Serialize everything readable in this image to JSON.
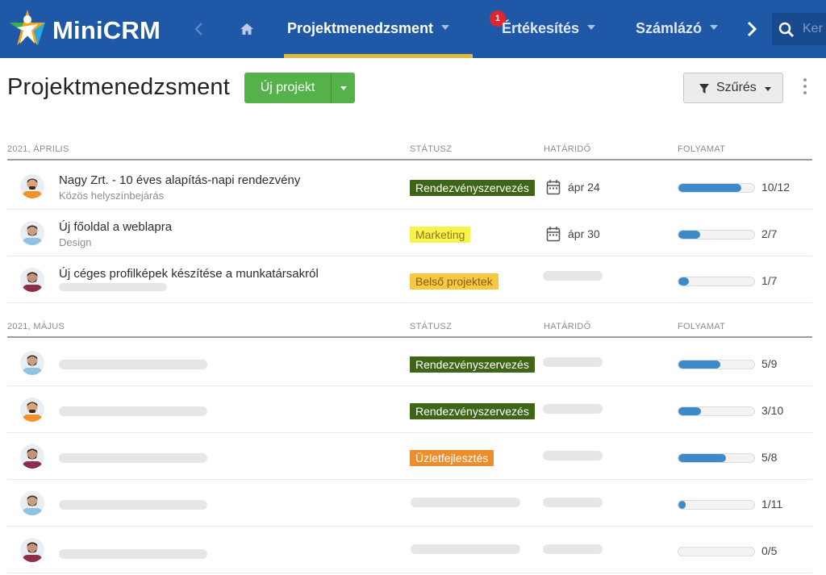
{
  "app": {
    "brand": "MiniCRM",
    "logo_icon": "star-person-logo",
    "colors": {
      "topbar": "#1f58a6",
      "accent_underline": "#e3b93b",
      "primary_button": "#55b24a",
      "progress": "#3d8ac9"
    }
  },
  "nav": {
    "back_icon": "chevron-left-icon",
    "home_icon": "home-icon",
    "tabs": [
      {
        "label": "Projektmenedzsment",
        "active": true
      },
      {
        "label": "Értékesítés",
        "badge": "1"
      },
      {
        "label": "Számlázó"
      }
    ],
    "next_icon": "chevron-right-icon",
    "search_placeholder": "Ker"
  },
  "header": {
    "title": "Projektmenedzsment",
    "new_button": "Új projekt",
    "filter_button": "Szűrés"
  },
  "groups": [
    {
      "label": "2021, ÁPRILIS",
      "columns": {
        "status": "STÁTUSZ",
        "due": "HATÁRIDŐ",
        "progress": "FOLYAMAT"
      },
      "rows": [
        {
          "title": "Nagy Zrt. - 10 éves alapítás-napi rendezvény",
          "subtitle": "Közös helyszínbejárás",
          "status": "Rendezvényszervezés",
          "status_color": "#3d6617",
          "due": "ápr 24",
          "progress_text": "10/12",
          "progress": 0.8333,
          "avatar": "orange"
        },
        {
          "title": "Új főoldal a weblapra",
          "subtitle": "Design",
          "status": "Marketing",
          "status_color": "#f8f34a",
          "due": "ápr 30",
          "progress_text": "2/7",
          "progress": 0.2857,
          "avatar": "blue"
        },
        {
          "title": "Új céges profilképek készítése a munkatársakról",
          "subtitle": "",
          "status": "Belső projektek",
          "status_color": "#f6c945",
          "due": "",
          "progress_text": "1/7",
          "progress": 0.1429,
          "avatar": "maroon"
        }
      ]
    },
    {
      "label": "2021, MÁJUS",
      "columns": {
        "status": "STÁTUSZ",
        "due": "HATÁRIDŐ",
        "progress": "FOLYAMAT"
      },
      "rows": [
        {
          "status": "Rendezvényszervezés",
          "status_color": "#3d6617",
          "progress_text": "5/9",
          "progress": 0.5556,
          "avatar": "blue"
        },
        {
          "status": "Rendezvényszervezés",
          "status_color": "#3d6617",
          "progress_text": "3/10",
          "progress": 0.3,
          "avatar": "orange"
        },
        {
          "status": "Üzletfejlesztés",
          "status_color": "#ec8e2c",
          "progress_text": "5/8",
          "progress": 0.625,
          "avatar": "maroon"
        },
        {
          "status": "",
          "progress_text": "1/11",
          "progress": 0.0909,
          "avatar": "blue"
        },
        {
          "status": "",
          "progress_text": "0/5",
          "progress": 0,
          "avatar": "maroon"
        }
      ]
    }
  ]
}
